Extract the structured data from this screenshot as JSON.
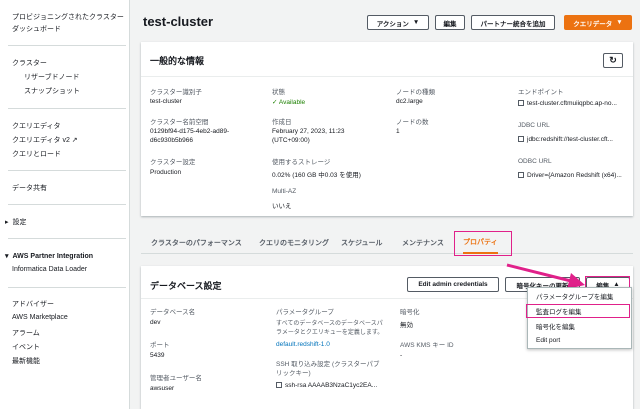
{
  "sidebar": {
    "items": [
      {
        "label": "プロビジョニングされたクラスター",
        "sub": false
      },
      {
        "label": "ダッシュボード",
        "sub": false
      },
      {
        "label": "クラスター",
        "sub": false
      },
      {
        "label": "リザーブドノード",
        "sub": true
      },
      {
        "label": "スナップショット",
        "sub": true
      },
      {
        "label": "クエリエディタ",
        "sub": false
      },
      {
        "label": "クエリエディタ v2 ↗",
        "sub": false
      },
      {
        "label": "クエリとロード",
        "sub": false
      },
      {
        "label": "データ共有",
        "sub": false
      },
      {
        "label": "設定",
        "sub": false
      },
      {
        "label": "AWS Partner Integration",
        "sub": false
      },
      {
        "label": "Informatica Data Loader",
        "sub": false
      },
      {
        "label": "アドバイザー",
        "sub": false
      },
      {
        "label": "AWS Marketplace",
        "sub": false
      },
      {
        "label": "アラーム",
        "sub": false
      },
      {
        "label": "イベント",
        "sub": false
      },
      {
        "label": "最新機能",
        "sub": false
      }
    ]
  },
  "header": {
    "title": "test-cluster",
    "actions_label": "アクション",
    "edit_label": "編集",
    "partner_label": "パートナー統合を追加",
    "query_label": "クエリデータ"
  },
  "general": {
    "title": "一般的な情報",
    "cluster_id_label": "クラスター識別子",
    "cluster_id": "test-cluster",
    "namespace_label": "クラスター名前空間",
    "namespace_line1": "0129bf94-d175-4eb2-ad89-",
    "namespace_line2": "d6c930b5b966",
    "config_label": "クラスター設定",
    "config": "Production",
    "status_label": "状態",
    "status": "Available",
    "created_label": "作成日",
    "created_line1": "February 27, 2023, 11:23",
    "created_line2": "(UTC+09:00)",
    "storage_label": "使用するストレージ",
    "storage": "0.02% (160 GB 中0.03 を使用)",
    "multiaz_label": "Multi-AZ",
    "multiaz": "いいえ",
    "nodetype_label": "ノードの種類",
    "nodetype": "dc2.large",
    "nodes_label": "ノードの数",
    "nodes": "1",
    "endpoint_label": "エンドポイント",
    "endpoint": "test-cluster.cftmuiiqpbc.ap-no...",
    "jdbc_label": "JDBC URL",
    "jdbc": "jdbc:redshift://test-cluster.cft...",
    "odbc_label": "ODBC URL",
    "odbc": "Driver={Amazon Redshift (x64)..."
  },
  "tabs": [
    "クラスターのパフォーマンス",
    "クエリのモニタリング",
    "スケジュール",
    "メンテナンス",
    "プロパティ"
  ],
  "db": {
    "title": "データベース設定",
    "edit_admin_label": "Edit admin credentials",
    "update_key_label": "暗号化キーの更新",
    "edit_label": "編集",
    "dbname_label": "データベース名",
    "dbname": "dev",
    "port_label": "ポート",
    "port": "5439",
    "admin_label": "管理者ユーザー名",
    "admin": "awsuser",
    "param_label": "パラメータグループ",
    "param_desc_line1": "すべてのデータベースのデータベースパ",
    "param_desc_line2": "ラメータとクエリキューを定義します。",
    "param": "default.redshift-1.0",
    "ssh_label_line1": "SSH 取り込み設定 (クラスターパブ",
    "ssh_label_line2": "リックキー)",
    "ssh": "ssh-rsa AAAAB3NzaC1yc2EA...",
    "enc_label": "暗号化",
    "enc": "無効",
    "kms_label": "AWS KMS キー ID",
    "kms": "-"
  },
  "menu": {
    "items": [
      "パラメータグループを編集",
      "監査ログを編集",
      "暗号化を編集",
      "Edit port"
    ]
  },
  "colors": {
    "accent": "#ec7211",
    "highlight": "#e0218a",
    "link": "#0073bb",
    "success": "#1d8102"
  }
}
